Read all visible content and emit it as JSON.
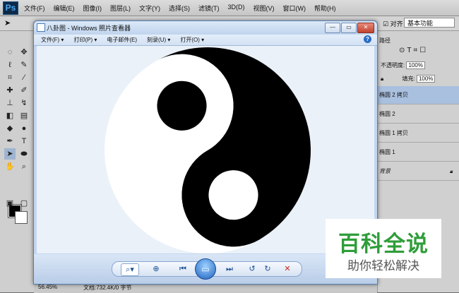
{
  "photoshop": {
    "logo": "Ps",
    "menus": [
      "文件(F)",
      "编辑(E)",
      "图像(I)",
      "图层(L)",
      "文字(Y)",
      "选择(S)",
      "滤镜(T)",
      "3D(D)",
      "视图(V)",
      "窗口(W)",
      "帮助(H)"
    ],
    "options": {
      "auto_select_label": "对齐",
      "workspace": "基本功能"
    },
    "layers_panel": {
      "tab": "路径",
      "opacity_label": "不透明度:",
      "opacity_value": "100%",
      "fill_label": "填充:",
      "fill_value": "100%",
      "layers": [
        "椭圆 2 拷贝",
        "椭圆 2",
        "椭圆 1 拷贝",
        "椭圆 1",
        "背景"
      ]
    },
    "status": {
      "zoom": "56.45%",
      "doc": "文档:732.4K/0 字节"
    }
  },
  "viewer": {
    "title": "八卦图 - Windows 照片查看器",
    "menus": [
      "文件(F) ▾",
      "打印(P) ▾",
      "电子邮件(E)",
      "刻录(U) ▾",
      "打开(O) ▾"
    ],
    "help": "?",
    "controls": {
      "zoom": "⌕▾",
      "fit": "⊕",
      "prev": "⏮",
      "slideshow": "▭",
      "next": "⏭",
      "rotate_ccw": "↺",
      "rotate_cw": "↻",
      "delete": "✕"
    }
  },
  "watermark": {
    "line1": "百科全说",
    "line2": "助你轻松解决"
  },
  "colors": {
    "ps_bg": "#6e6e6e",
    "viewer_canvas": "#ebf1f9",
    "watermark_green": "#2f9d3a",
    "selected_layer": "#a9c0df"
  }
}
